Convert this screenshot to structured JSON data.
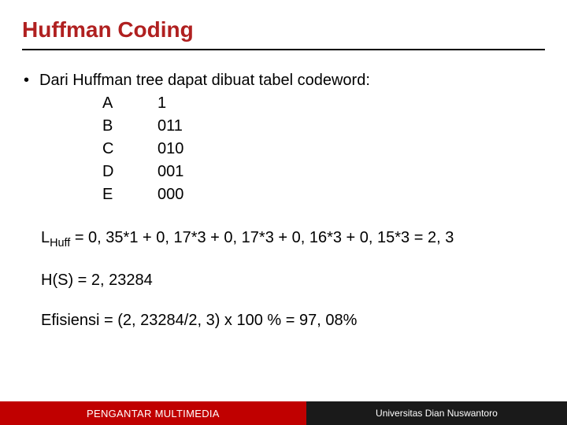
{
  "title": "Huffman Coding",
  "lead_text": "Dari Huffman tree dapat dibuat tabel codeword:",
  "codewords": [
    {
      "symbol": "A",
      "code": "1"
    },
    {
      "symbol": "B",
      "code": "011"
    },
    {
      "symbol": "C",
      "code": "010"
    },
    {
      "symbol": "D",
      "code": "001"
    },
    {
      "symbol": "E",
      "code": "000"
    }
  ],
  "formula_L_prefix": "L",
  "formula_L_sub": "Huff",
  "formula_L_rest": " = 0, 35*1 + 0, 17*3 + 0, 17*3 + 0, 16*3 + 0, 15*3 = 2, 3",
  "formula_H": "H(S) = 2, 23284",
  "formula_eff": "Efisiensi = (2, 23284/2, 3) x 100 % = 97, 08%",
  "footer": {
    "left": "PENGANTAR MULTIMEDIA",
    "right": "Universitas Dian Nuswantoro"
  }
}
